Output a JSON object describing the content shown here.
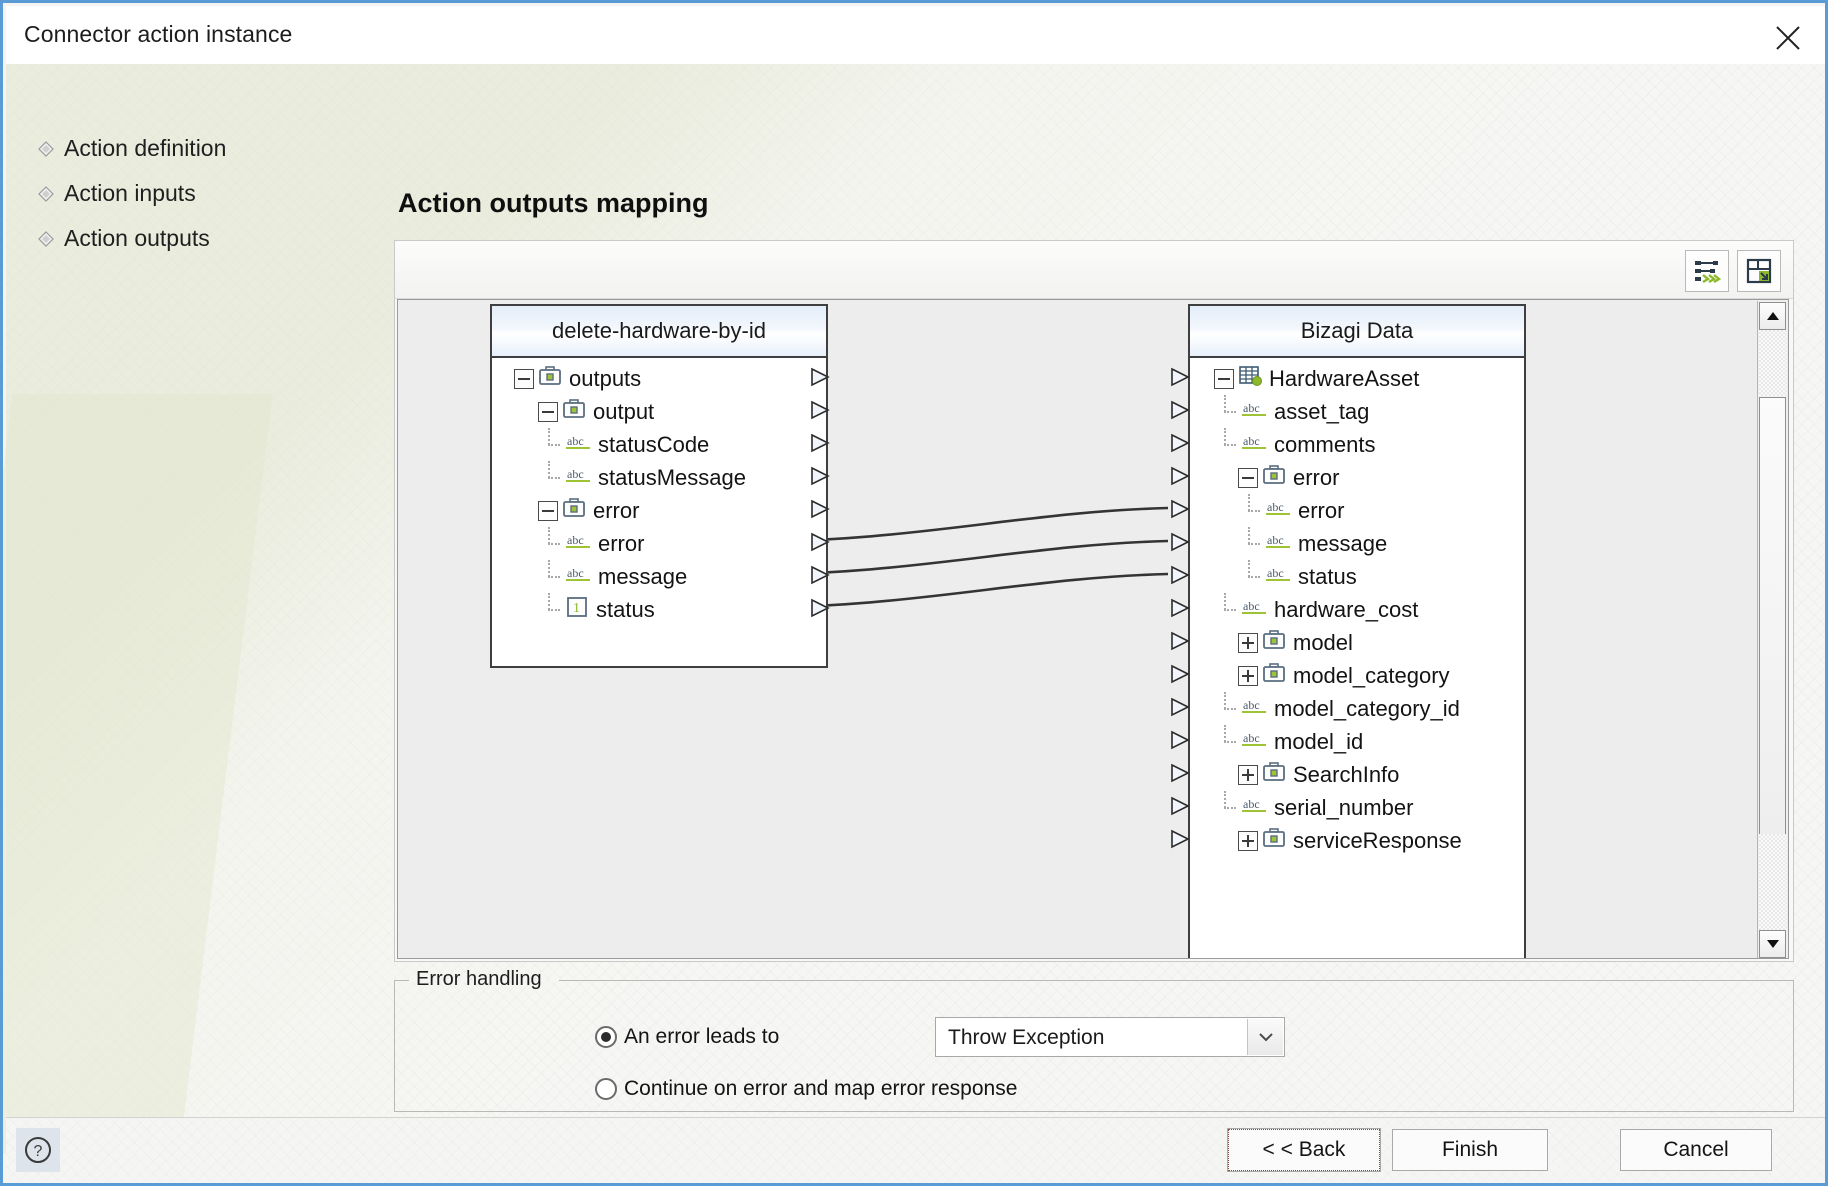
{
  "window": {
    "title": "Connector action instance",
    "close_icon": "close-icon"
  },
  "steps": [
    {
      "label": "Action definition"
    },
    {
      "label": "Action inputs"
    },
    {
      "label": "Action outputs"
    }
  ],
  "main": {
    "page_title": "Action outputs mapping"
  },
  "toolbar": {
    "automap_icon": "auto-map-icon",
    "savemap_icon": "save-mapping-icon"
  },
  "mapper": {
    "left_tree": {
      "header": "delete-hardware-by-id",
      "nodes": [
        {
          "label": "outputs",
          "icon": "complex-type-icon",
          "depth": 0,
          "twisty": "minus",
          "connector": "line"
        },
        {
          "label": "output",
          "icon": "complex-type-icon",
          "depth": 1,
          "twisty": "minus",
          "connector": "line"
        },
        {
          "label": "statusCode",
          "icon": "string-type-icon",
          "depth": 2,
          "twisty": "none",
          "connector": "tee"
        },
        {
          "label": "statusMessage",
          "icon": "string-type-icon",
          "depth": 2,
          "twisty": "none",
          "connector": "last"
        },
        {
          "label": "error",
          "icon": "complex-type-icon",
          "depth": 1,
          "twisty": "minus",
          "connector": "line"
        },
        {
          "label": "error",
          "icon": "string-type-icon",
          "depth": 2,
          "twisty": "none",
          "connector": "tee"
        },
        {
          "label": "message",
          "icon": "string-type-icon",
          "depth": 2,
          "twisty": "none",
          "connector": "tee"
        },
        {
          "label": "status",
          "icon": "integer-type-icon",
          "depth": 2,
          "twisty": "none",
          "connector": "last"
        }
      ]
    },
    "right_tree": {
      "header": "Bizagi Data",
      "nodes": [
        {
          "label": "HardwareAsset",
          "icon": "entity-table-icon",
          "depth": 0,
          "twisty": "minus",
          "connector": "none"
        },
        {
          "label": "asset_tag",
          "icon": "string-type-icon",
          "depth": 1,
          "twisty": "none",
          "connector": "tee"
        },
        {
          "label": "comments",
          "icon": "string-type-icon",
          "depth": 1,
          "twisty": "none",
          "connector": "tee"
        },
        {
          "label": "error",
          "icon": "complex-type-icon",
          "depth": 1,
          "twisty": "minus",
          "connector": "line"
        },
        {
          "label": "error",
          "icon": "string-type-icon",
          "depth": 2,
          "twisty": "none",
          "connector": "tee"
        },
        {
          "label": "message",
          "icon": "string-type-icon",
          "depth": 2,
          "twisty": "none",
          "connector": "tee"
        },
        {
          "label": "status",
          "icon": "string-type-icon",
          "depth": 2,
          "twisty": "none",
          "connector": "last"
        },
        {
          "label": "hardware_cost",
          "icon": "string-type-icon",
          "depth": 1,
          "twisty": "none",
          "connector": "tee"
        },
        {
          "label": "model",
          "icon": "complex-type-icon",
          "depth": 1,
          "twisty": "plus",
          "connector": "none"
        },
        {
          "label": "model_category",
          "icon": "complex-type-icon",
          "depth": 1,
          "twisty": "plus",
          "connector": "none"
        },
        {
          "label": "model_category_id",
          "icon": "string-type-icon",
          "depth": 1,
          "twisty": "none",
          "connector": "tee"
        },
        {
          "label": "model_id",
          "icon": "string-type-icon",
          "depth": 1,
          "twisty": "none",
          "connector": "tee"
        },
        {
          "label": "SearchInfo",
          "icon": "complex-type-icon",
          "depth": 1,
          "twisty": "plus",
          "connector": "none"
        },
        {
          "label": "serial_number",
          "icon": "string-type-icon",
          "depth": 1,
          "twisty": "none",
          "connector": "tee"
        },
        {
          "label": "serviceResponse",
          "icon": "complex-type-icon",
          "depth": 1,
          "twisty": "plus",
          "connector": "none"
        }
      ]
    },
    "mappings": [
      {
        "from": "error",
        "to": "error"
      },
      {
        "from": "message",
        "to": "message"
      },
      {
        "from": "status",
        "to": "status"
      }
    ],
    "scrollbar": {
      "up_icon": "scroll-up-icon",
      "down_icon": "scroll-down-icon"
    }
  },
  "error_handling": {
    "group_title": "Error handling",
    "option_1": "An error leads to",
    "option_2": "Continue on error and map error response",
    "selected_option": "option_1",
    "select_value": "Throw Exception",
    "select_options": [
      "Throw Exception"
    ],
    "dropdown_icon": "chevron-down-icon"
  },
  "footer": {
    "help_icon": "help-icon",
    "back_label": "< < Back",
    "finish_label": "Finish",
    "cancel_label": "Cancel"
  },
  "colors": {
    "accent": "#5b9bd5",
    "green": "#8cb82b",
    "header_blue": "#e4edfa"
  }
}
